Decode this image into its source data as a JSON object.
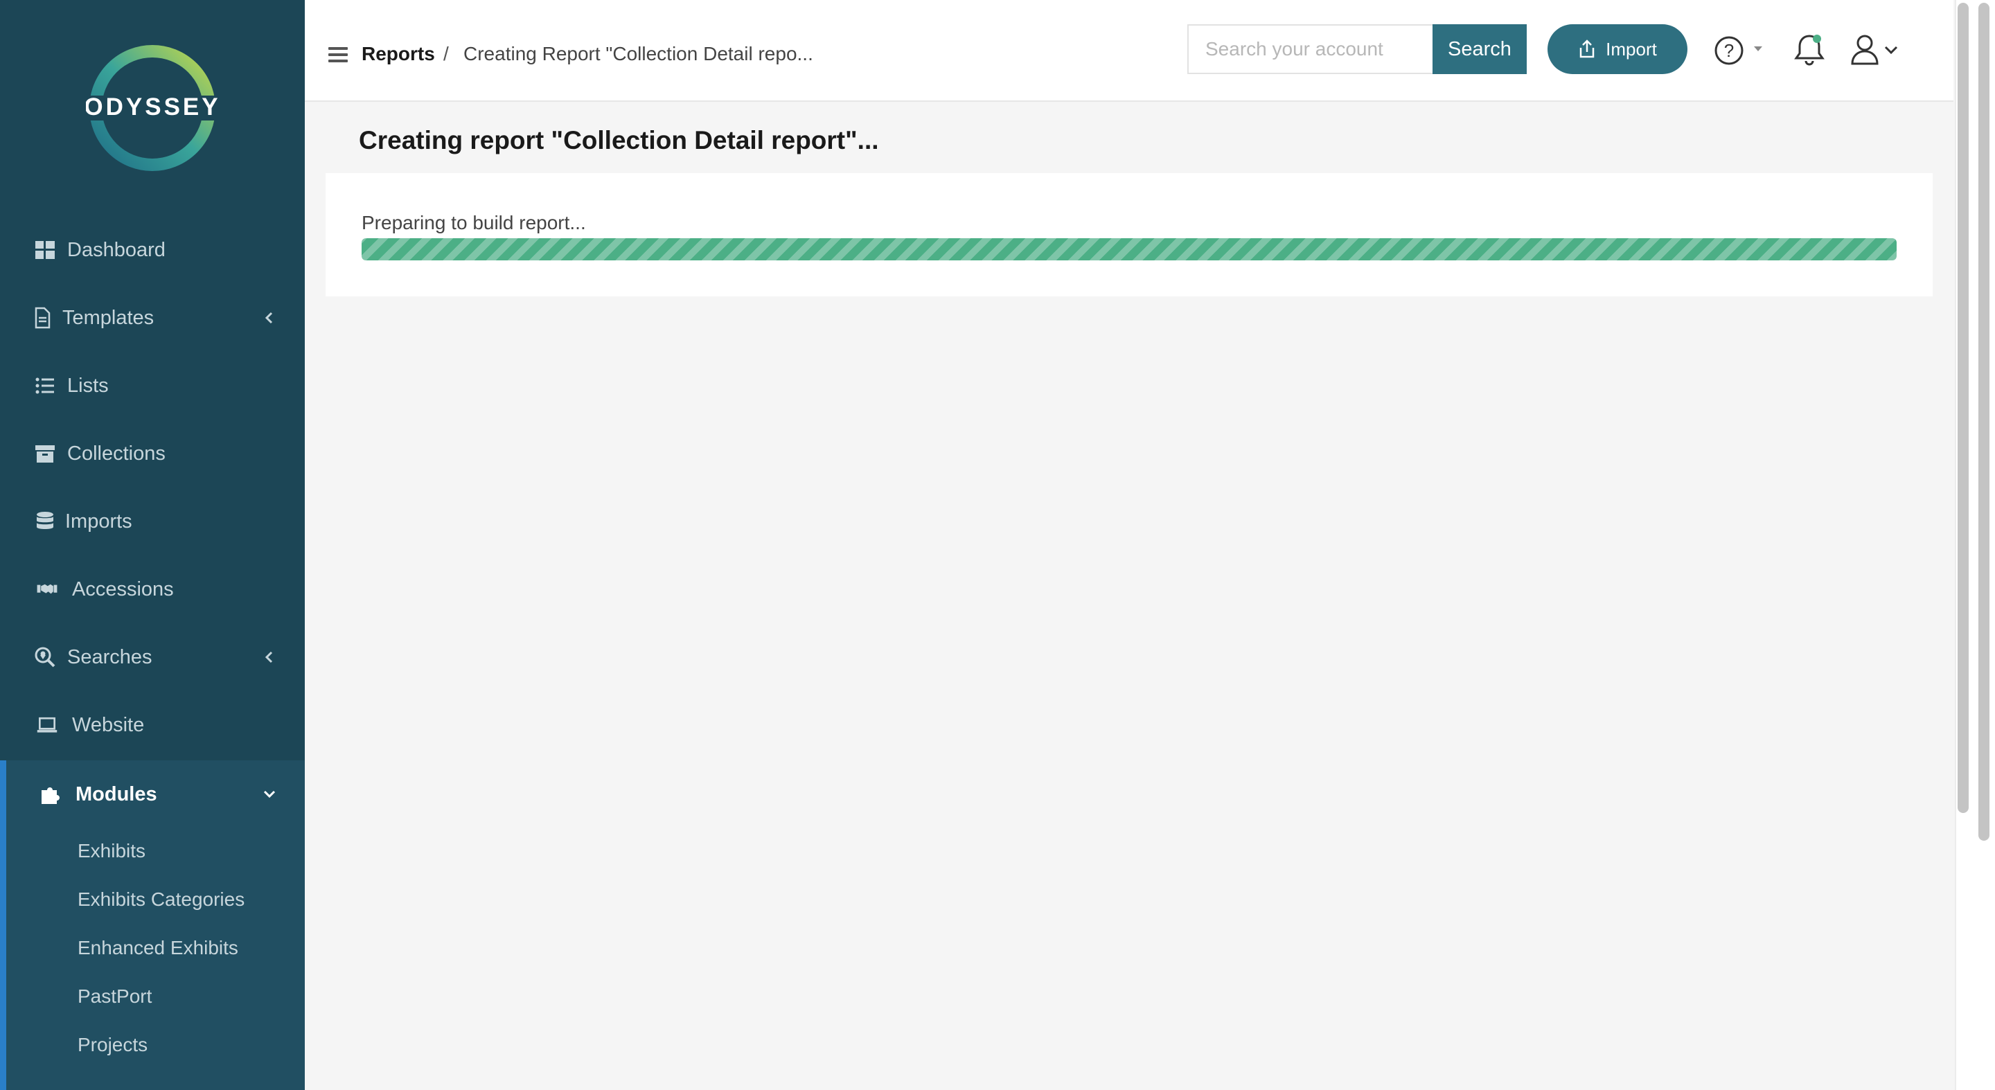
{
  "brand": {
    "logo_text": "ODYSSEY",
    "colors": {
      "sidebar": "#1c4656",
      "accent": "#2e6f80",
      "progress": "#4caf86",
      "logo_ring_start": "#2a7d8f",
      "logo_ring_end": "#c3d84a"
    }
  },
  "sidebar": {
    "items": [
      {
        "label": "Dashboard",
        "icon": "dashboard-icon"
      },
      {
        "label": "Templates",
        "icon": "document-icon",
        "has_submenu": true
      },
      {
        "label": "Lists",
        "icon": "list-icon"
      },
      {
        "label": "Collections",
        "icon": "archive-icon"
      },
      {
        "label": "Imports",
        "icon": "database-icon"
      },
      {
        "label": "Accessions",
        "icon": "handshake-icon"
      },
      {
        "label": "Searches",
        "icon": "search-location-icon",
        "has_submenu": true
      },
      {
        "label": "Website",
        "icon": "laptop-icon"
      },
      {
        "label": "Modules",
        "icon": "puzzle-icon",
        "expanded": true
      }
    ],
    "modules_subitems": [
      "Exhibits",
      "Exhibits Categories",
      "Enhanced Exhibits",
      "PastPort",
      "Projects"
    ]
  },
  "header": {
    "breadcrumb_root": "Reports",
    "breadcrumb_separator": "/",
    "breadcrumb_current": "Creating Report \"Collection Detail repo...",
    "search_placeholder": "Search your account",
    "search_button": "Search",
    "import_button": "Import"
  },
  "main": {
    "page_title": "Creating report \"Collection Detail report\"...",
    "status_text": "Preparing to build report...",
    "progress_fraction": 1.0
  }
}
